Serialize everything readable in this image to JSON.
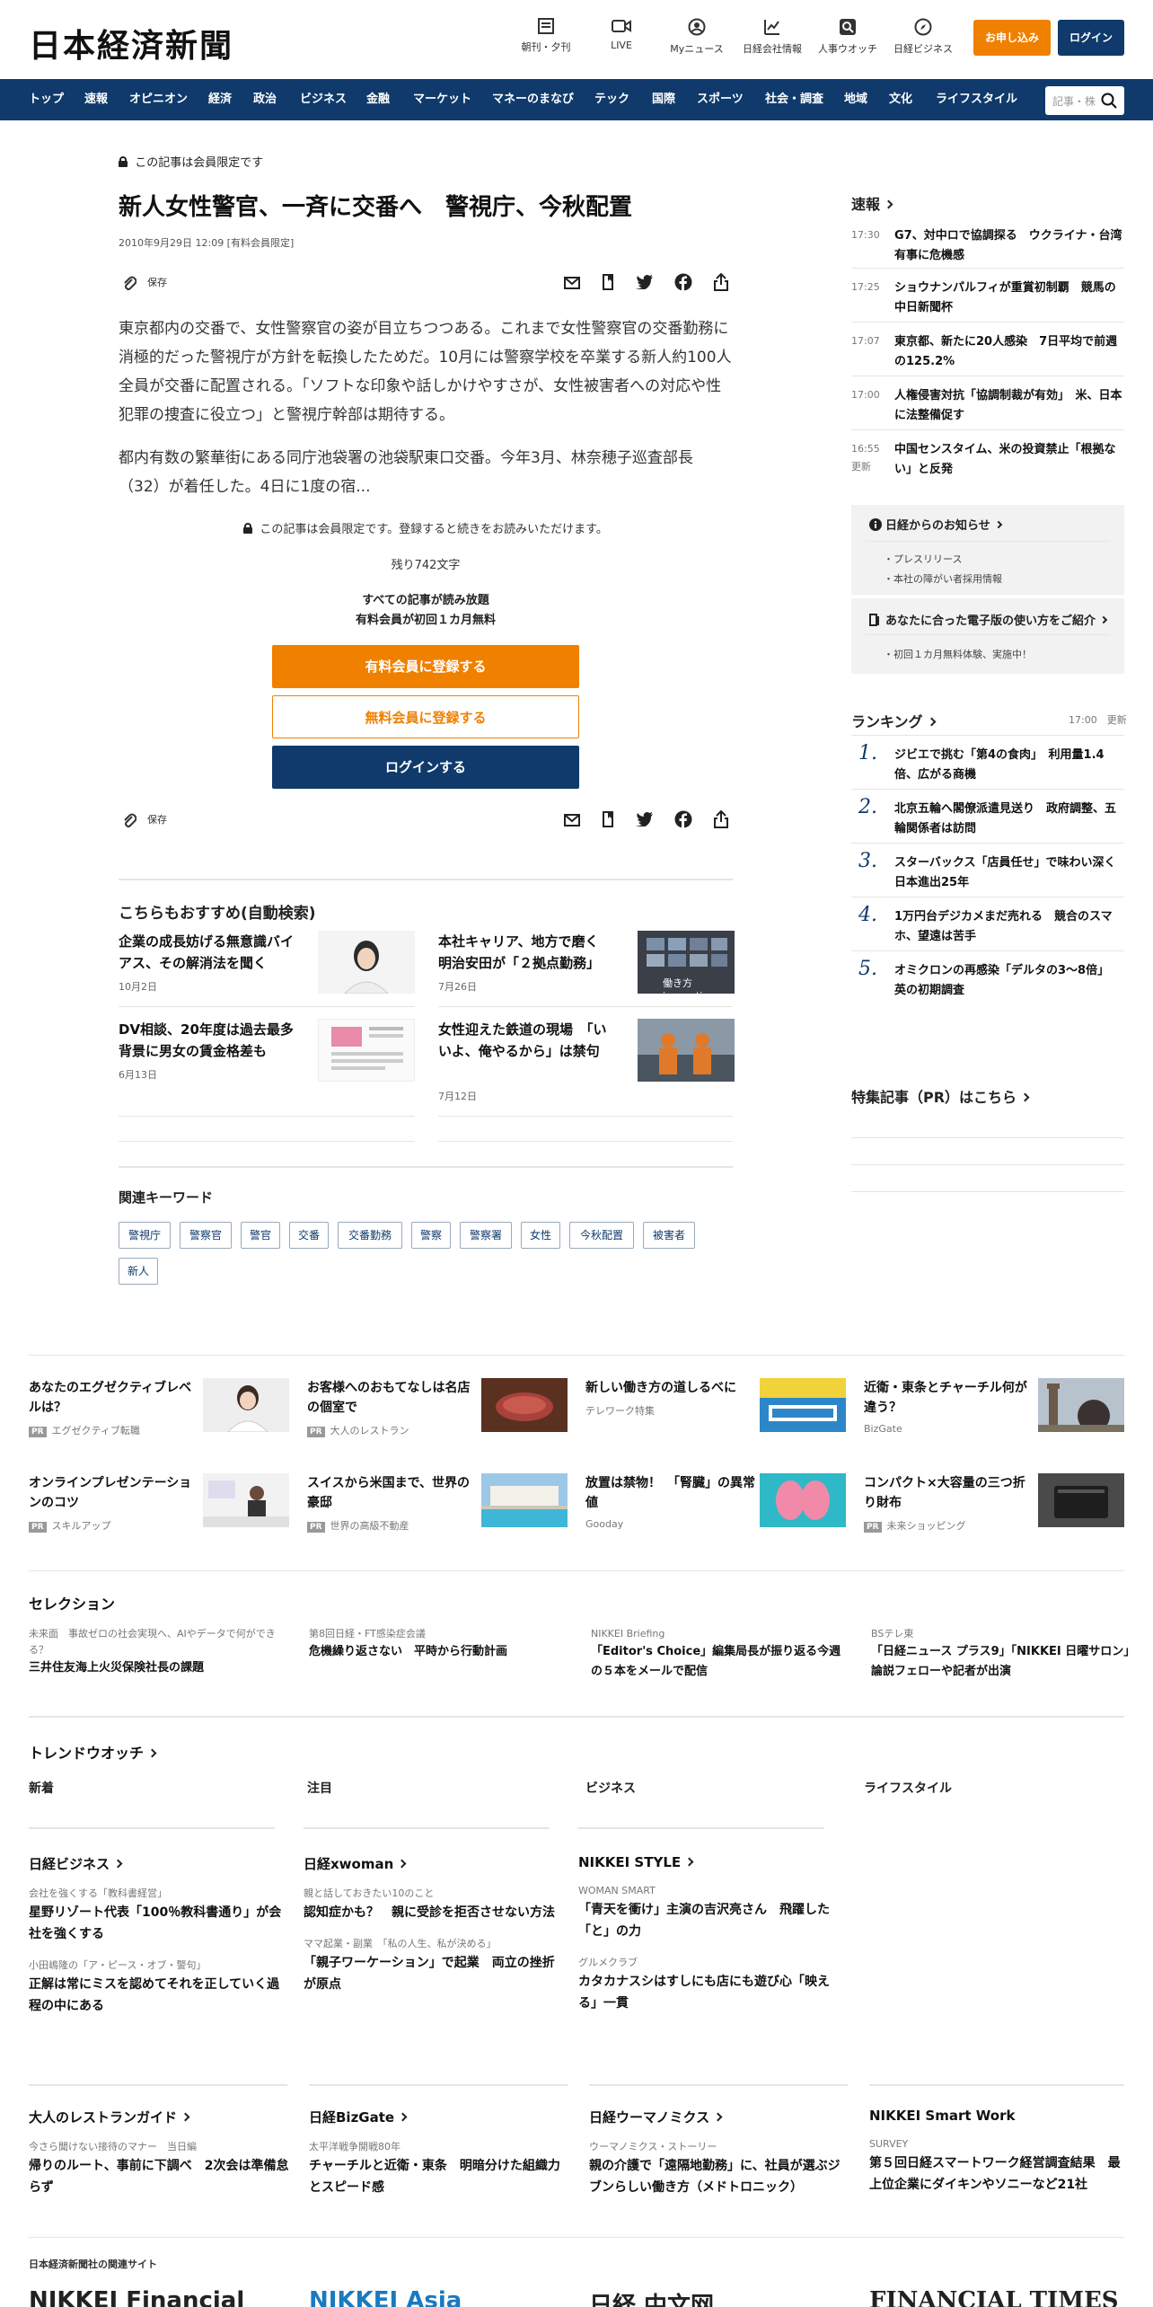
{
  "header": {
    "logo": "日本経済新聞",
    "icons": [
      {
        "label": "朝刊・夕刊",
        "icon": "newspaper-icon"
      },
      {
        "label": "LIVE",
        "icon": "video-icon"
      },
      {
        "label": "Myニュース",
        "icon": "user-icon"
      },
      {
        "label": "日経会社情報",
        "icon": "chart-icon"
      },
      {
        "label": "人事ウオッチ",
        "icon": "search-person-icon"
      },
      {
        "label": "日経ビジネス",
        "icon": "compass-icon"
      }
    ],
    "apply_label": "お申し込み",
    "login_label": "ログイン"
  },
  "nav": {
    "items": [
      "トップ",
      "速報",
      "オピニオン",
      "経済",
      "政治",
      "ビジネス",
      "金融",
      "マーケット",
      "マネーのまなび",
      "テック",
      "国際",
      "スポーツ",
      "社会・調査",
      "地域",
      "文化",
      "ライフスタイル"
    ],
    "search_placeholder": "記事・株"
  },
  "article": {
    "member_only": "この記事は会員限定です",
    "title": "新人女性警官、一斉に交番へ　警視庁、今秋配置",
    "date": "2010年9月29日 12:09 [有料会員限定]",
    "save_label": "保存",
    "paragraphs": [
      "東京都内の交番で、女性警察官の姿が目立ちつつある。これまで女性警察官の交番勤務に消極的だった警視庁が方針を転換したためだ。10月には警察学校を卒業する新人約100人全員が交番に配置される。「ソフトな印象や話しかけやすさが、女性被害者への対応や性犯罪の捜査に役立つ」と警視庁幹部は期待する。",
      "都内有数の繁華街にある同庁池袋署の池袋駅東口交番。今年3月、林奈穂子巡査部長（32）が着任した。4日に1度の宿..."
    ],
    "paywall_note": "この記事は会員限定です。登録すると続きをお読みいただけます。",
    "remaining": "残り742文字",
    "read_all_1": "すべての記事が読み放題",
    "read_all_2": "有料会員が初回１カ月無料",
    "cta_paid": "有料会員に登録する",
    "cta_free": "無料会員に登録する",
    "cta_login": "ログインする"
  },
  "recommend": {
    "title": "こちらもおすすめ(自動検索)",
    "items": [
      {
        "title": "企業の成長妨げる無意識バイアス、その解消法を聞く",
        "date": "10月2日"
      },
      {
        "title": "本社キャリア、地方で磨く　明治安田が「２拠点勤務」",
        "date": "7月26日"
      },
      {
        "title": "DV相談、20年度は過去最多　背景に男女の賃金格差も",
        "date": "6月13日"
      },
      {
        "title": "女性迎えた鉄道の現場　「いいよ、俺やるから」は禁句",
        "date": "7月12日"
      }
    ],
    "thumb_caption": "働き方innovation"
  },
  "keywords": {
    "title": "関連キーワード",
    "items": [
      "警視庁",
      "警察官",
      "警官",
      "交番",
      "交番勤務",
      "警察",
      "警察署",
      "女性",
      "今秋配置",
      "被害者",
      "新人"
    ]
  },
  "sidebar": {
    "sokuho_title": "速報",
    "sokuho": [
      {
        "time": "17:30",
        "text": "G7、対中ロで協調探る　ウクライナ・台湾有事に危機感"
      },
      {
        "time": "17:25",
        "text": "ショウナンパルフィが重賞初制覇　競馬の中日新聞杯"
      },
      {
        "time": "17:07",
        "text": "東京都、新たに20人感染　7日平均で前週の125.2%"
      },
      {
        "time": "17:00",
        "text": "人権侵害対抗「協調制裁が有効」　米、日本に法整備促す"
      },
      {
        "time": "16:55",
        "time2": "更新",
        "text": "中国センスタイム、米の投資禁止「根拠ない」と反発"
      }
    ],
    "notice_title": "日経からのお知らせ",
    "notice_items": [
      "プレスリリース",
      "本社の障がい者採用情報"
    ],
    "ebook_title": "あなたに合った電子版の使い方をご紹介",
    "ebook_items": [
      "初回１カ月無料体験、実施中！"
    ],
    "ranking_title": "ランキング",
    "ranking_updated": "17:00　更新",
    "ranking": [
      {
        "n": "1.",
        "text": "ジビエで挑む「第4の食肉」　利用量1.4倍、広がる商機"
      },
      {
        "n": "2.",
        "text": "北京五輪へ閣僚派遣見送り　政府調整、五輪関係者は訪問"
      },
      {
        "n": "3.",
        "text": "スターバックス「店員任せ」で味わい深く　日本進出25年"
      },
      {
        "n": "4.",
        "text": "1万円台デジカメまだ売れる　競合のスマホ、望遠は苦手"
      },
      {
        "n": "5.",
        "text": "オミクロンの再感染「デルタの3～8倍」　英の初期調査"
      }
    ],
    "pr_title": "特集記事（PR）はこちら"
  },
  "ads": [
    {
      "title": "あなたのエグゼクティブレベルは？",
      "source": "エグゼクティブ転職",
      "pr": true
    },
    {
      "title": "お客様へのおもてなしは名店の個室で",
      "source": "大人のレストラン",
      "pr": true
    },
    {
      "title": "新しい働き方の道しるべに",
      "source": "テレワーク特集",
      "pr": false
    },
    {
      "title": "近衛・東条とチャーチル何が違う？",
      "source": "BizGate",
      "pr": false
    },
    {
      "title": "オンラインプレゼンテーションのコツ",
      "source": "スキルアップ",
      "pr": true
    },
    {
      "title": "スイスから米国まで、世界の豪邸",
      "source": "世界の高級不動産",
      "pr": true
    },
    {
      "title": "放置は禁物！　「腎臓」の異常値",
      "source": "Gooday",
      "pr": false
    },
    {
      "title": "コンパクト×大容量の三つ折り財布",
      "source": "未来ショッピング",
      "pr": true
    }
  ],
  "ad_pr_badge": "PR",
  "selection": {
    "title": "セレクション",
    "items": [
      {
        "cat": "未来面　事故ゼロの社会実現へ、AIやデータで何ができる？",
        "title": "三井住友海上火災保険社長の課題"
      },
      {
        "cat": "第8回日経・FT感染症会議",
        "title": "危機繰り返さない　平時から行動計画"
      },
      {
        "cat": "NIKKEI Briefing",
        "title": "「Editor's Choice」編集局長が振り返る今週の５本をメールで配信"
      },
      {
        "cat": "BSテレ東",
        "title": "「日経ニュース プラス9」「NIKKEI 日曜サロン」論説フェローや記者が出演"
      }
    ]
  },
  "trend": {
    "title": "トレンドウオッチ",
    "tabs": [
      "新着",
      "注目",
      "ビジネス",
      "ライフスタイル"
    ]
  },
  "media1": [
    {
      "head": "日経ビジネス",
      "items": [
        {
          "cat": "会社を強くする「教科書経営」",
          "title": "星野リゾート代表「100％教科書通り」が会社を強くする"
        },
        {
          "cat": "小田嶋隆の「ア・ピース・オブ・警句」",
          "title": "正解は常にミスを認めてそれを正していく過程の中にある"
        }
      ]
    },
    {
      "head": "日経xwoman",
      "items": [
        {
          "cat": "親と話しておきたい10のこと",
          "title": "認知症かも？　親に受診を拒否させない方法"
        },
        {
          "cat": "ママ起業・副業　「私の人生、私が決める」",
          "title": "「親子ワーケーション」で起業　両立の挫折が原点"
        }
      ]
    },
    {
      "head": "NIKKEI STYLE",
      "items": [
        {
          "cat": "WOMAN SMART",
          "title": "「青天を衝け」主演の吉沢亮さん　飛躍した「と」の力"
        },
        {
          "cat": "グルメクラブ",
          "title": "カタカナスシはすしにも店にも遊び心「映える」一貫"
        }
      ]
    }
  ],
  "media2": [
    {
      "head": "大人のレストランガイド",
      "cat": "今さら聞けない接待のマナー　当日編",
      "title": "帰りのルート、事前に下調べ　2次会は準備怠らず"
    },
    {
      "head": "日経BizGate",
      "cat": "太平洋戦争開戦80年",
      "title": "チャーチルと近衛・東条　明暗分けた組織力とスピード感"
    },
    {
      "head": "日経ウーマノミクス",
      "cat": "ウーマノミクス・ストーリー",
      "title": "親の介護で「遠隔地勤務」に、社員が選ぶジブンらしい働き方（メドトロニック）"
    },
    {
      "head": "NIKKEI Smart Work",
      "cat": "SURVEY",
      "title": "第５回日経スマートワーク経営調査結果　最上位企業にダイキンやソニーなど21社"
    }
  ],
  "footer": {
    "related_title": "日本経済新聞社の関連サイト",
    "logos": [
      "NIKKEI Financial",
      "NIKKEI Asia",
      "日経 中文网",
      "FINANCIAL TIMES"
    ]
  },
  "colors": {
    "brand": "#0f3a6b",
    "accent": "#f08000"
  }
}
